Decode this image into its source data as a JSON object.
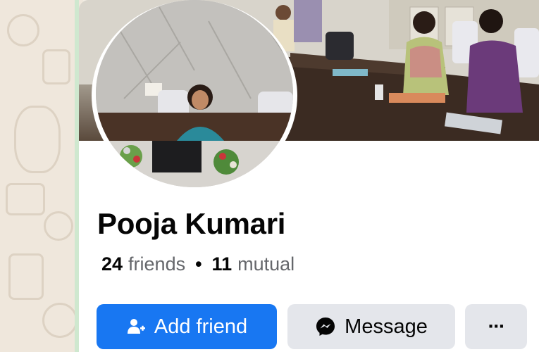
{
  "profile": {
    "name": "Pooja Kumari",
    "friends_count": "24",
    "friends_label": "friends",
    "separator": "•",
    "mutual_count": "11",
    "mutual_label": "mutual"
  },
  "actions": {
    "add_friend_label": "Add friend",
    "message_label": "Message",
    "more_label": "···"
  },
  "colors": {
    "primary_button": "#1877f2",
    "secondary_button": "#e4e6eb",
    "text_primary": "#050505",
    "text_secondary": "#65676b"
  },
  "icons": {
    "add_friend": "add-person-icon",
    "message": "messenger-icon",
    "more": "more-dots-icon"
  }
}
